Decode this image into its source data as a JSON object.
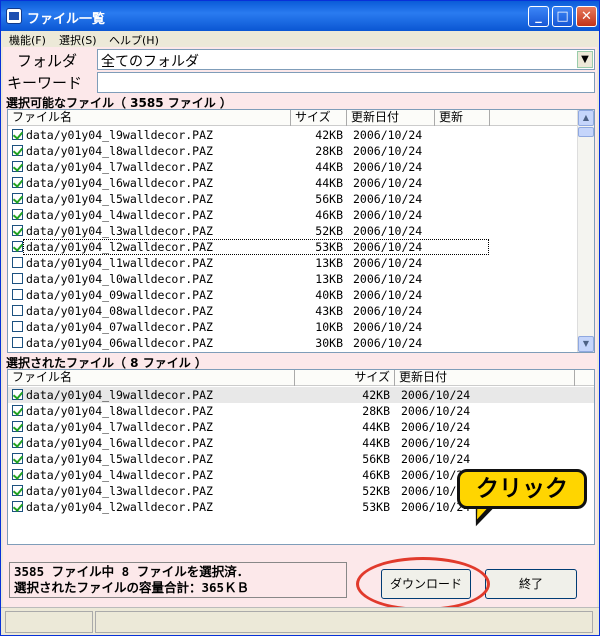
{
  "window": {
    "title": "ファイル一覧",
    "minimize": "_",
    "maximize": "□",
    "close": "✕"
  },
  "menu": [
    "機能(F)",
    "選択(S)",
    "ヘルプ(H)"
  ],
  "folder": {
    "label": "フォルダ",
    "value": "全てのフォルダ"
  },
  "keyword": {
    "label": "キーワード",
    "value": ""
  },
  "available": {
    "title": "選択可能なファイル（ 3585 ファイル ）",
    "columns": [
      "ファイル名",
      "サイズ",
      "更新日付",
      "更新"
    ],
    "rows": [
      {
        "checked": true,
        "name": "data/y01y04_l9walldecor.PAZ",
        "size": "42KB",
        "date": "2006/10/24"
      },
      {
        "checked": true,
        "name": "data/y01y04_l8walldecor.PAZ",
        "size": "28KB",
        "date": "2006/10/24"
      },
      {
        "checked": true,
        "name": "data/y01y04_l7walldecor.PAZ",
        "size": "44KB",
        "date": "2006/10/24"
      },
      {
        "checked": true,
        "name": "data/y01y04_l6walldecor.PAZ",
        "size": "44KB",
        "date": "2006/10/24"
      },
      {
        "checked": true,
        "name": "data/y01y04_l5walldecor.PAZ",
        "size": "56KB",
        "date": "2006/10/24"
      },
      {
        "checked": true,
        "name": "data/y01y04_l4walldecor.PAZ",
        "size": "46KB",
        "date": "2006/10/24"
      },
      {
        "checked": true,
        "name": "data/y01y04_l3walldecor.PAZ",
        "size": "52KB",
        "date": "2006/10/24"
      },
      {
        "checked": true,
        "name": "data/y01y04_l2walldecor.PAZ",
        "size": "53KB",
        "date": "2006/10/24"
      },
      {
        "checked": false,
        "name": "data/y01y04_l1walldecor.PAZ",
        "size": "13KB",
        "date": "2006/10/24"
      },
      {
        "checked": false,
        "name": "data/y01y04_l0walldecor.PAZ",
        "size": "13KB",
        "date": "2006/10/24"
      },
      {
        "checked": false,
        "name": "data/y01y04_09walldecor.PAZ",
        "size": "40KB",
        "date": "2006/10/24"
      },
      {
        "checked": false,
        "name": "data/y01y04_08walldecor.PAZ",
        "size": "43KB",
        "date": "2006/10/24"
      },
      {
        "checked": false,
        "name": "data/y01y04_07walldecor.PAZ",
        "size": "10KB",
        "date": "2006/10/24"
      },
      {
        "checked": false,
        "name": "data/y01y04_06walldecor.PAZ",
        "size": "30KB",
        "date": "2006/10/24"
      }
    ]
  },
  "selected": {
    "title": "選択されたファイル（ 8 ファイル ）",
    "columns": [
      "ファイル名",
      "サイズ",
      "更新日付"
    ],
    "rows": [
      {
        "checked": true,
        "name": "data/y01y04_l9walldecor.PAZ",
        "size": "42KB",
        "date": "2006/10/24"
      },
      {
        "checked": true,
        "name": "data/y01y04_l8walldecor.PAZ",
        "size": "28KB",
        "date": "2006/10/24"
      },
      {
        "checked": true,
        "name": "data/y01y04_l7walldecor.PAZ",
        "size": "44KB",
        "date": "2006/10/24"
      },
      {
        "checked": true,
        "name": "data/y01y04_l6walldecor.PAZ",
        "size": "44KB",
        "date": "2006/10/24"
      },
      {
        "checked": true,
        "name": "data/y01y04_l5walldecor.PAZ",
        "size": "56KB",
        "date": "2006/10/24"
      },
      {
        "checked": true,
        "name": "data/y01y04_l4walldecor.PAZ",
        "size": "46KB",
        "date": "2006/10/24"
      },
      {
        "checked": true,
        "name": "data/y01y04_l3walldecor.PAZ",
        "size": "52KB",
        "date": "2006/10/24"
      },
      {
        "checked": true,
        "name": "data/y01y04_l2walldecor.PAZ",
        "size": "53KB",
        "date": "2006/10/24"
      }
    ]
  },
  "status": {
    "line1": "3585 ファイル中 8 ファイルを選択済．",
    "line2": "選択されたファイルの容量合計：365ＫＢ"
  },
  "buttons": {
    "download": "ダウンロード",
    "exit": "終了"
  },
  "callout": {
    "text": "クリック"
  },
  "scroll": {
    "up": "▲",
    "down": "▼"
  },
  "colors": {
    "titlebar": "#0a5bd8",
    "panel": "#fce8ea",
    "callout": "#ffd500",
    "ring": "#e13a2c",
    "check": "#21a121"
  }
}
